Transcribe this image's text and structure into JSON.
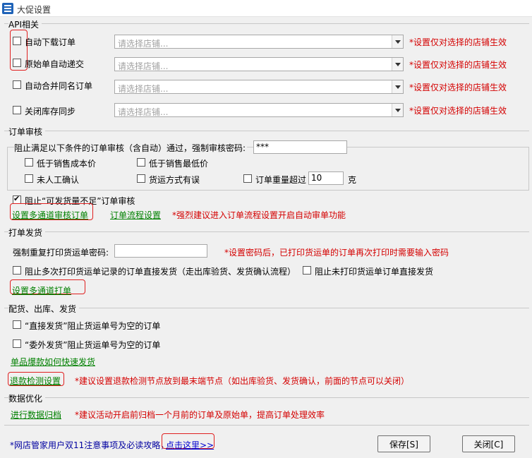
{
  "window": {
    "title": "大促设置"
  },
  "api": {
    "section_title": "API相关",
    "rows": [
      {
        "label": "自动下载订单",
        "placeholder": "请选择店铺...",
        "note": "*设置仅对选择的店铺生效"
      },
      {
        "label": "原始单自动递交",
        "placeholder": "请选择店铺...",
        "note": "*设置仅对选择的店铺生效"
      },
      {
        "label": "自动合并同名订单",
        "placeholder": "请选择店铺...",
        "note": "*设置仅对选择的店铺生效"
      },
      {
        "label": "关闭库存同步",
        "placeholder": "请选择店铺...",
        "note": "*设置仅对选择的店铺生效"
      }
    ]
  },
  "audit": {
    "section_title": "订单审核",
    "prevent_label": "阻止满足以下条件的订单审核（含自动）通过，强制审核密码:",
    "password_value": "***",
    "options": {
      "below_cost": "低于销售成本价",
      "below_min": "低于销售最低价",
      "unconfirmed": "未人工确认",
      "shipping_error": "货运方式有误",
      "weight_over": "订单重量超过",
      "weight_value": "10",
      "weight_unit": "克"
    },
    "block_insufficient": "阻止“可发货量不足”订单审核",
    "link_multichannel": "设置多通道审核订单",
    "link_flow": "订单流程设置",
    "note": "*强烈建议进入订单流程设置开启自动审单功能"
  },
  "print": {
    "section_title": "打单发货",
    "reprint_label": "强制重复打印货运单密码:",
    "reprint_value": "",
    "reprint_note": "*设置密码后，已打印货运单的订单再次打印时需要输入密码",
    "block_multi": "阻止多次打印货运单记录的订单直接发货（走出库验货、发货确认流程）",
    "block_unprinted": "阻止未打印货运单订单直接发货",
    "link_multichannel": "设置多通道打单"
  },
  "ship": {
    "section_title": "配货、出库、发货",
    "direct_ship": "“直接发货”阻止货运单号为空的订单",
    "outsource_ship": "“委外发货”阻止货运单号为空的订单",
    "link_fast": "单品爆款如何快速发货",
    "link_refund": "退款检测设置",
    "refund_note": "*建议设置退款检测节点放到最末端节点（如出库验货、发货确认，前面的节点可以关闭）"
  },
  "optimize": {
    "section_title": "数据优化",
    "link_archive": "进行数据归档",
    "archive_note": "*建议活动开启前归档一个月前的订单及原始单，提高订单处理效率"
  },
  "footer": {
    "notice": "*网店管家用户双11注意事项及必读攻略，",
    "link_here": "点击这里>>",
    "save_label": "保存[S]",
    "close_label": "关闭[C]"
  },
  "colors": {
    "note_red": "#d40000",
    "link_green": "#008000",
    "link_blue": "#0000d0",
    "highlight_red": "#e02020"
  }
}
